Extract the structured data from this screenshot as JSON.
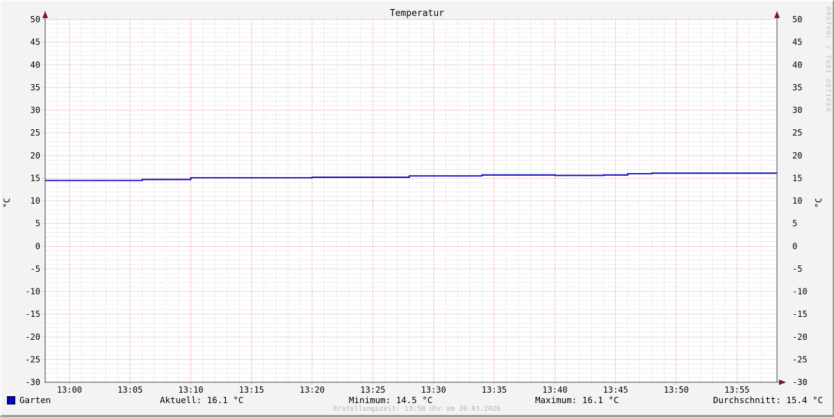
{
  "title": "Temperatur",
  "watermark": "RRDTOOL / TOBI OETIKER",
  "axis_unit_left": "°C",
  "axis_unit_right": "°C",
  "legend": {
    "series_label": "Garten",
    "aktuell": "Aktuell: 16.1 °C",
    "minimum": "Minimum: 14.5 °C",
    "maximum": "Maximum: 16.1 °C",
    "durchschnitt": "Durchschnitt: 15.4 °C"
  },
  "footer": {
    "created": "Erstellungszeit: 13:58 Uhr am 20.03.2026"
  },
  "colors": {
    "background": "#f3f3f3",
    "canvas": "#ffffff",
    "major_grid": "#f0a2a2",
    "minor_grid": "#cdcdcd",
    "axis": "#404040",
    "arrow": "#801515",
    "series": "#0000cc",
    "text": "#000000",
    "footer_text": "#b5b5b5",
    "watermark_text": "#bbbbbb"
  },
  "chart_data": {
    "type": "line",
    "title": "Temperatur",
    "ylabel": "°C",
    "ylabel_right": "°C",
    "ylim": [
      -30,
      50
    ],
    "y_tick_step": 5,
    "y_minor_step": 1,
    "grid": true,
    "legend_position": "bottom",
    "x_start": "12:58",
    "x_end": "13:58",
    "total_minutes": 60.3,
    "x_minor_step_minutes": 1,
    "x_tick_labels": [
      "13:00",
      "13:05",
      "13:10",
      "13:15",
      "13:20",
      "13:25",
      "13:30",
      "13:35",
      "13:40",
      "13:45",
      "13:50",
      "13:55"
    ],
    "x_tick_minutes": [
      2,
      7,
      12,
      17,
      22,
      27,
      32,
      37,
      42,
      47,
      52,
      57
    ],
    "series": [
      {
        "name": "Garten",
        "color": "#0000cc",
        "steps_minute_value": [
          [
            0,
            14.5
          ],
          [
            8,
            14.7
          ],
          [
            12,
            15.1
          ],
          [
            22,
            15.2
          ],
          [
            30,
            15.5
          ],
          [
            36,
            15.7
          ],
          [
            42,
            15.6
          ],
          [
            46,
            15.7
          ],
          [
            48,
            16.0
          ],
          [
            50,
            16.1
          ]
        ],
        "end_minute": 60.3
      }
    ],
    "stats": {
      "aktuell_c": 16.1,
      "minimum_c": 14.5,
      "maximum_c": 16.1,
      "durchschnitt_c": 15.4
    }
  }
}
